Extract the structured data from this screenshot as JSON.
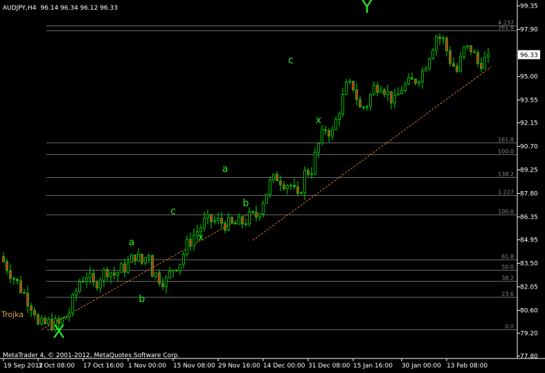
{
  "header": {
    "symbol": "AUDJPY,H4",
    "ohlc": "96.14 96.34 96.12 96.33"
  },
  "footer": {
    "copyright": "MetaTrader 4, © 2001-2012, MetaQuotes Software Corp."
  },
  "indicator_label": "Trojka",
  "colors": {
    "background": "#000000",
    "candle_up": "#00e000",
    "candle_down": "#e02020",
    "wave_label": "#22ee22",
    "level_line": "#6a6a6a",
    "level_text": "#8a8a8a",
    "trend_line": "#e07820",
    "axis": "#ffffff",
    "price_box_bg": "#ffffff"
  },
  "chart_data": {
    "type": "candlestick",
    "title": "AUDJPY,H4",
    "ylim": [
      77.8,
      99.35
    ],
    "y_ticks": [
      "99.35",
      "97.90",
      "96.33",
      "95.00",
      "93.55",
      "92.15",
      "90.70",
      "89.25",
      "87.80",
      "86.35",
      "84.95",
      "83.50",
      "82.05",
      "80.60",
      "79.20",
      "77.80"
    ],
    "y_tick_values": [
      99.35,
      97.9,
      96.33,
      95.0,
      93.55,
      92.15,
      90.7,
      89.25,
      87.8,
      86.35,
      84.95,
      83.5,
      82.05,
      80.6,
      79.2,
      77.8
    ],
    "current_price": "96.33",
    "x_ticks": [
      "19 Sep 2012",
      "3 Oct 08:00",
      "17 Oct 16:00",
      "1 Nov 00:00",
      "15 Nov 08:00",
      "29 Nov 16:00",
      "14 Dec 00:00",
      "31 Dec 08:00",
      "15 Jan 16:00",
      "30 Jan 00:00",
      "13 Feb 08:00"
    ],
    "x_tick_index": [
      0,
      10,
      23,
      36,
      49,
      62,
      75,
      88,
      101,
      115,
      128
    ],
    "bar_count": 141,
    "close_path": [
      [
        0,
        83.6
      ],
      [
        3,
        82.6
      ],
      [
        6,
        81.6
      ],
      [
        9,
        80.6
      ],
      [
        10,
        79.6
      ],
      [
        13,
        79.8
      ],
      [
        16,
        79.7
      ],
      [
        19,
        80.5
      ],
      [
        22,
        82.4
      ],
      [
        24,
        82.8
      ],
      [
        26,
        82.1
      ],
      [
        28,
        82.7
      ],
      [
        30,
        83.1
      ],
      [
        32,
        82.8
      ],
      [
        36,
        83.4
      ],
      [
        38,
        84.0
      ],
      [
        40,
        83.5
      ],
      [
        42,
        84.2
      ],
      [
        43,
        83.0
      ],
      [
        45,
        82.6
      ],
      [
        47,
        82.4
      ],
      [
        49,
        83.2
      ],
      [
        51,
        83.6
      ],
      [
        53,
        84.6
      ],
      [
        55,
        85.2
      ],
      [
        58,
        86.0
      ],
      [
        60,
        86.1
      ],
      [
        63,
        86.0
      ],
      [
        66,
        85.8
      ],
      [
        69,
        86.0
      ],
      [
        71,
        86.3
      ],
      [
        73,
        86.4
      ],
      [
        75,
        87.4
      ],
      [
        77,
        88.4
      ],
      [
        79,
        88.8
      ],
      [
        81,
        88.5
      ],
      [
        83,
        88.3
      ],
      [
        85,
        87.4
      ],
      [
        87,
        89.0
      ],
      [
        89,
        89.3
      ],
      [
        91,
        90.8
      ],
      [
        93,
        91.8
      ],
      [
        95,
        91.5
      ],
      [
        97,
        93.0
      ],
      [
        99,
        94.3
      ],
      [
        101,
        94.4
      ],
      [
        103,
        93.0
      ],
      [
        105,
        93.3
      ],
      [
        107,
        94.3
      ],
      [
        109,
        94.6
      ],
      [
        111,
        93.9
      ],
      [
        113,
        93.4
      ],
      [
        115,
        94.3
      ],
      [
        117,
        94.5
      ],
      [
        119,
        94.8
      ],
      [
        121,
        95.3
      ],
      [
        123,
        96.4
      ],
      [
        125,
        97.5
      ],
      [
        127,
        97.2
      ],
      [
        129,
        96.0
      ],
      [
        131,
        95.3
      ],
      [
        133,
        96.6
      ],
      [
        135,
        96.7
      ],
      [
        137,
        95.8
      ],
      [
        139,
        96.0
      ],
      [
        140,
        96.33
      ]
    ],
    "fib_levels": [
      {
        "label": "4.237",
        "price": 98.1
      },
      {
        "label": "261.8",
        "price": 97.8
      },
      {
        "label": "161.8",
        "price": 90.9
      },
      {
        "label": "100.0",
        "price": 90.2
      },
      {
        "label": "138.2",
        "price": 88.8
      },
      {
        "label": "1.227",
        "price": 87.7
      },
      {
        "label": "100.0",
        "price": 86.5
      },
      {
        "label": "61.8",
        "price": 83.7
      },
      {
        "label": "50.0",
        "price": 83.1
      },
      {
        "label": "38.2",
        "price": 82.4
      },
      {
        "label": "23.6",
        "price": 81.4
      },
      {
        "label": "0.0",
        "price": 79.4
      }
    ],
    "trend_lines": [
      {
        "x1": 11,
        "y1": 79.4,
        "x2": 71,
        "y2": 86.55
      },
      {
        "x1": 72,
        "y1": 84.9,
        "x2": 141,
        "y2": 95.6
      }
    ],
    "wave_labels": [
      {
        "text": "X",
        "x": 16,
        "y": 78.9,
        "size": "large"
      },
      {
        "text": "a",
        "x": 37,
        "y": 84.6,
        "size": "small"
      },
      {
        "text": "b",
        "x": 40,
        "y": 81.1,
        "size": "small"
      },
      {
        "text": "c",
        "x": 49,
        "y": 86.5,
        "size": "small"
      },
      {
        "text": "x",
        "x": 57,
        "y": 84.9,
        "size": "small"
      },
      {
        "text": "a",
        "x": 64,
        "y": 89.1,
        "size": "small"
      },
      {
        "text": "b",
        "x": 70,
        "y": 87.0,
        "size": "small"
      },
      {
        "text": "c",
        "x": 83,
        "y": 95.8,
        "size": "small"
      },
      {
        "text": "x",
        "x": 91,
        "y": 92.1,
        "size": "small"
      },
      {
        "text": "Y",
        "x": 105,
        "y": 98.9,
        "size": "large"
      }
    ]
  }
}
